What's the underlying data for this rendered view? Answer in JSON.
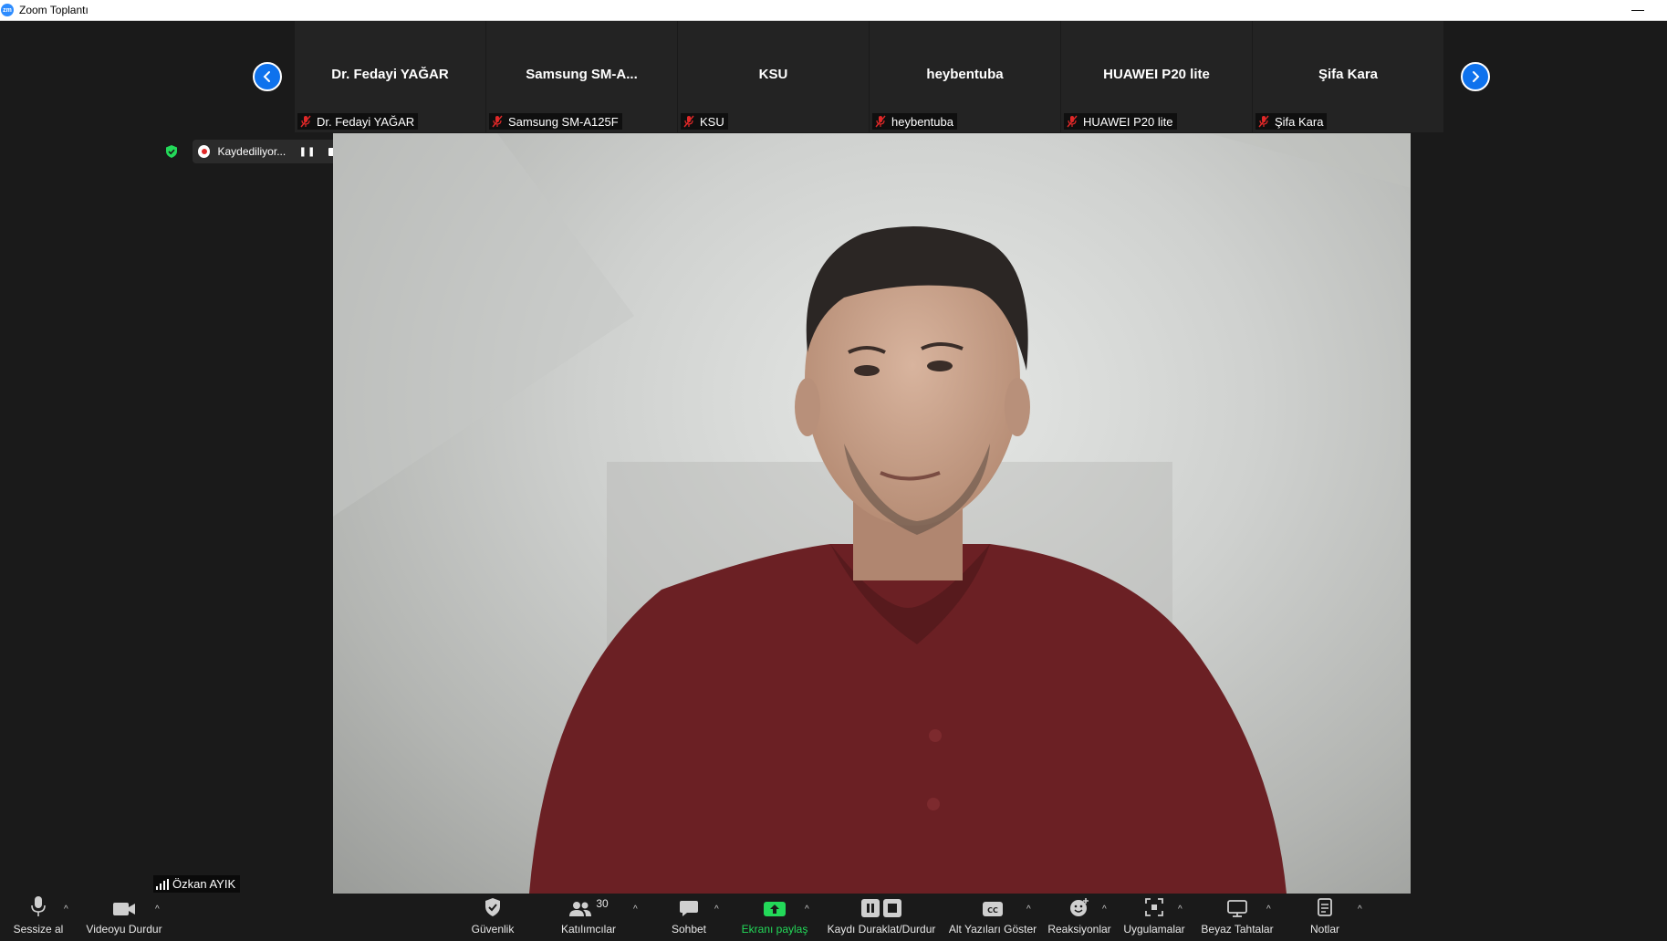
{
  "window": {
    "title": "Zoom Toplantı",
    "logo_text": "zm",
    "minimize_glyph": "—"
  },
  "participants_strip": [
    {
      "name": "Dr. Fedayi YAĞAR",
      "label": "Dr. Fedayi YAĞAR"
    },
    {
      "name": "Samsung  SM-A...",
      "label": "Samsung SM-A125F"
    },
    {
      "name": "KSU",
      "label": "KSU"
    },
    {
      "name": "heybentuba",
      "label": "heybentuba"
    },
    {
      "name": "HUAWEI P20 lite",
      "label": "HUAWEI P20 lite"
    },
    {
      "name": "Şifa Kara",
      "label": "Şifa Kara"
    }
  ],
  "recording": {
    "status_text": "Kaydediliyor...",
    "pause_glyph": "❚❚"
  },
  "active_speaker": {
    "name": "Özkan AYIK"
  },
  "toolbar": {
    "mute": "Sessize al",
    "video": "Videoyu Durdur",
    "security": "Güvenlik",
    "participants": "Katılımcılar",
    "participants_count": "30",
    "chat": "Sohbet",
    "share": "Ekranı paylaş",
    "record": "Kaydı Duraklat/Durdur",
    "captions": "Alt Yazıları Göster",
    "captions_icon_text": "CC",
    "reactions": "Reaksiyonlar",
    "apps": "Uygulamalar",
    "whiteboard": "Beyaz Tahtalar",
    "notes": "Notlar",
    "caret_glyph": "^"
  },
  "colors": {
    "accent": "#0E72ED",
    "share_green": "#23D959",
    "background": "#1A1A1A",
    "muted_red": "#E02828"
  }
}
